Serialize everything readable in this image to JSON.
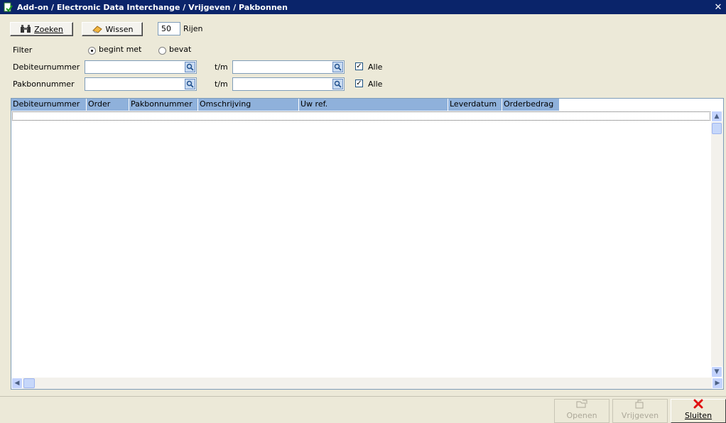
{
  "window": {
    "title": "Add-on / Electronic Data Interchange / Vrijgeven / Pakbonnen",
    "close_glyph": "✕"
  },
  "toolbar": {
    "search_label": "Zoeken",
    "clear_label": "Wissen",
    "rows_value": "50",
    "rows_label": "Rijen"
  },
  "filter": {
    "label": "Filter",
    "option_starts_with": "begint met",
    "option_contains": "bevat",
    "selected": "begint met"
  },
  "fields": {
    "debtor_label": "Debiteurnummer",
    "packslip_label": "Pakbonnummer",
    "to_label": "t/m",
    "all_label": "Alle",
    "debtor_all_checked": true,
    "packslip_all_checked": true,
    "check_glyph": "✓"
  },
  "grid": {
    "columns": [
      "Debiteurnummer",
      "Order",
      "Pakbonnummer",
      "Omschrijving",
      "Uw ref.",
      "Leverdatum",
      "Orderbedrag"
    ]
  },
  "actions": {
    "open_label": "Openen",
    "release_label": "Vrijgeven",
    "close_label": "Sluiten"
  },
  "colors": {
    "titlebar": "#0A246A",
    "header": "#8FB1DB",
    "window_bg": "#ECE9D8"
  }
}
